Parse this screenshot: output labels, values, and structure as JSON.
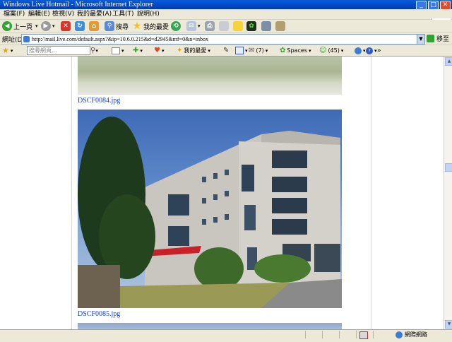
{
  "window": {
    "title": "Windows Live Hotmail - Microsoft Internet Explorer"
  },
  "menu": [
    "檔案(F)",
    "編輯(E)",
    "檢視(V)",
    "我的最愛(A)",
    "工具(T)",
    "說明(H)"
  ],
  "toolbar": {
    "back": "上一頁",
    "search": "搜尋",
    "favorites": "我的最愛"
  },
  "address": {
    "label": "網址(D)",
    "url": "http://mail.live.com/default.aspx?&ip=10.6.0.215&d=d2945&mf=0&n=inbox",
    "go": "移至"
  },
  "live_toolbar": {
    "search_placeholder": "搜尋網頁...",
    "favorites": "我的最愛",
    "mail_count": "(7)",
    "spaces": "Spaces",
    "contacts_count": "(45)"
  },
  "content": {
    "files": [
      "DSCF0084.jpg",
      "DSCF0085.jpg"
    ]
  },
  "status": {
    "zone": "網際網路"
  },
  "colors": {
    "link": "#1a3fc0",
    "titlebar": "#0048c8"
  }
}
